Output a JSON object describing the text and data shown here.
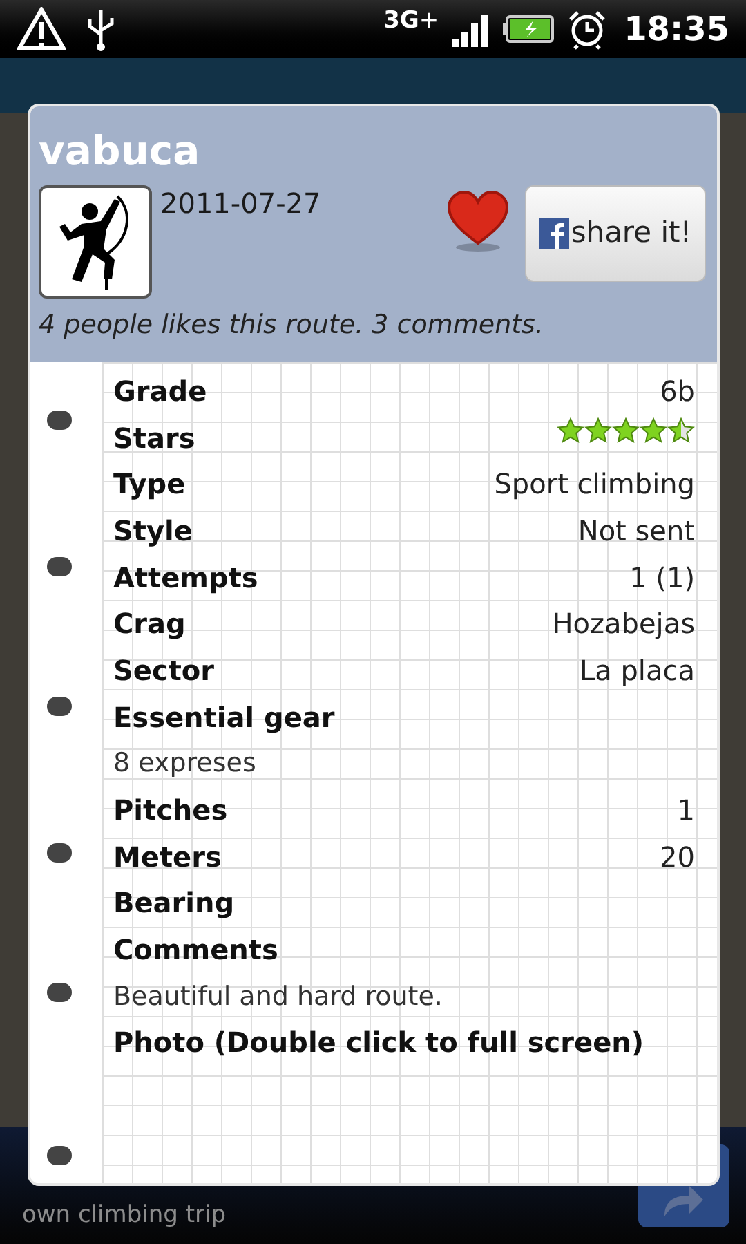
{
  "status_bar": {
    "network": "3G+",
    "time": "18:35"
  },
  "dialog": {
    "title": "vabuca",
    "date": "2011-07-27",
    "favorite": true,
    "share_button": "share it!",
    "summary": "4 people likes this route. 3 comments.",
    "rows": [
      {
        "kind": "pair",
        "label": "Grade",
        "value": "6b"
      },
      {
        "kind": "stars",
        "label": "Stars",
        "stars": 4.5
      },
      {
        "kind": "pair",
        "label": "Type",
        "value": "Sport climbing"
      },
      {
        "kind": "pair",
        "label": "Style",
        "value": "Not sent"
      },
      {
        "kind": "pair",
        "label": "Attempts",
        "value": "1 (1)"
      },
      {
        "kind": "pair",
        "label": "Crag",
        "value": "Hozabejas"
      },
      {
        "kind": "pair",
        "label": "Sector",
        "value": "La placa"
      },
      {
        "kind": "label",
        "label": "Essential gear"
      },
      {
        "kind": "text",
        "text": "8 expreses"
      },
      {
        "kind": "pair",
        "label": "Pitches",
        "value": "1"
      },
      {
        "kind": "pair",
        "label": "Meters",
        "value": "20"
      },
      {
        "kind": "label",
        "label": "Bearing"
      },
      {
        "kind": "label",
        "label": "Comments"
      },
      {
        "kind": "text",
        "text": "Beautiful and hard route."
      },
      {
        "kind": "label",
        "label": "Photo (Double click to full screen)"
      }
    ]
  },
  "ad_banner": {
    "lines": [
      "own climbing trip"
    ]
  }
}
